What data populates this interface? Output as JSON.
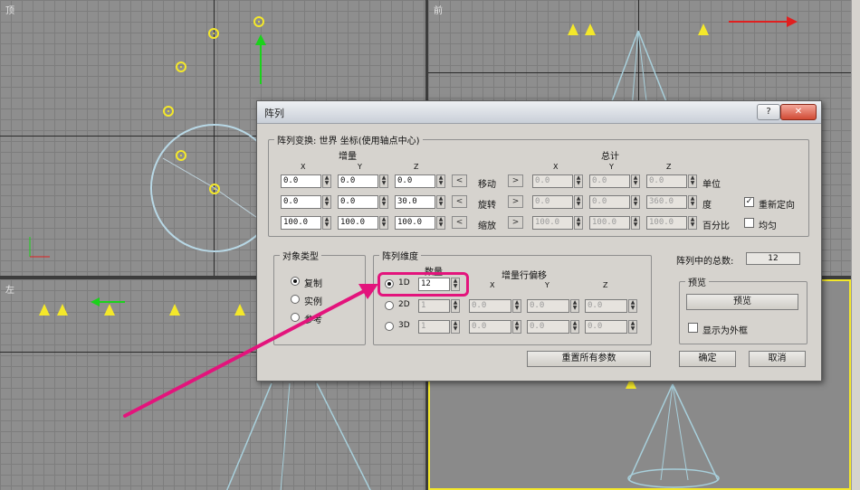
{
  "viewports": {
    "top_label": "顶",
    "front_label": "前",
    "left_label": "左"
  },
  "dialog": {
    "title": "阵列",
    "help_btn": "?",
    "close_btn": "✕",
    "transform_group": "阵列变换: 世界 坐标(使用轴点中心)",
    "increment_label": "增量",
    "total_label": "总计",
    "axis_x": "X",
    "axis_y": "Y",
    "axis_z": "Z",
    "rows": [
      {
        "label": "移动",
        "unit": "单位",
        "inc": [
          "0.0",
          "0.0",
          "0.0"
        ],
        "total": [
          "0.0",
          "0.0",
          "0.0"
        ]
      },
      {
        "label": "旋转",
        "unit": "度",
        "inc": [
          "0.0",
          "0.0",
          "30.0"
        ],
        "total": [
          "0.0",
          "0.0",
          "360.0"
        ]
      },
      {
        "label": "缩放",
        "unit": "百分比",
        "inc": [
          "100.0",
          "100.0",
          "100.0"
        ],
        "total": [
          "100.0",
          "100.0",
          "100.0"
        ]
      }
    ],
    "arrow_left": "<",
    "arrow_right": ">",
    "reorient_label": "重新定向",
    "reorient_checked": "✓",
    "uniform_label": "均匀",
    "object_type_group": "对象类型",
    "copy_label": "复制",
    "instance_label": "实例",
    "reference_label": "参考",
    "dimension_group": "阵列维度",
    "count_label": "数量",
    "row_offset_label": "增量行偏移",
    "dim_1d": "1D",
    "dim_2d": "2D",
    "dim_3d": "3D",
    "count_1d": "12",
    "count_2d": "1",
    "count_3d": "1",
    "offsets_2d": [
      "0.0",
      "0.0",
      "0.0"
    ],
    "offsets_3d": [
      "0.0",
      "0.0",
      "0.0"
    ],
    "total_count_label": "阵列中的总数:",
    "total_count_value": "12",
    "preview_group": "预览",
    "preview_btn": "预览",
    "show_box_label": "显示为外框",
    "reset_btn": "重置所有参数",
    "ok_btn": "确定",
    "cancel_btn": "取消"
  },
  "colors": {
    "highlight": "#e3147c",
    "gizmo": "#f4e82a",
    "active_border": "#f4e82a"
  }
}
